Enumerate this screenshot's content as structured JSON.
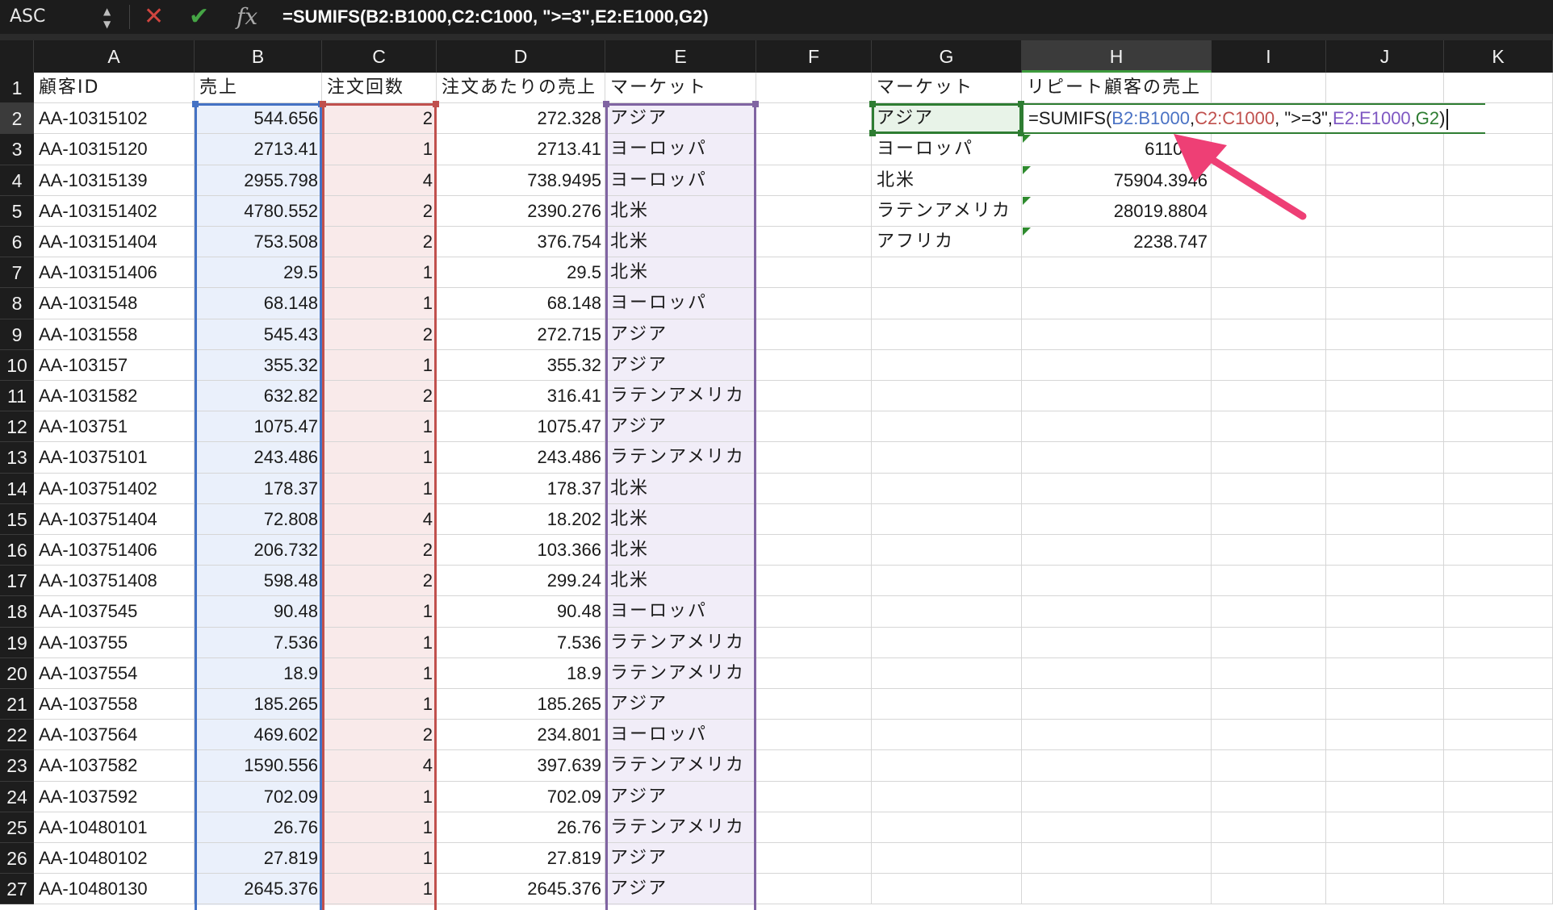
{
  "formula_bar": {
    "name_box": "ASC",
    "formula": "=SUMIFS(B2:B1000,C2:C1000, \">=3\",E2:E1000,G2)"
  },
  "icons": {
    "cancel": "cancel-icon",
    "confirm": "confirm-icon",
    "function": "fx-icon",
    "spinner": "spinner-icon"
  },
  "columns": [
    "A",
    "B",
    "C",
    "D",
    "E",
    "F",
    "G",
    "H",
    "I",
    "J",
    "K"
  ],
  "selected_column": "H",
  "selected_row": 2,
  "header_row": {
    "A": "顧客ID",
    "B": "売上",
    "C": "注文回数",
    "D": "注文あたりの売上",
    "E": "マーケット",
    "G": "マーケット",
    "H": "リピート顧客の売上"
  },
  "rows": [
    {
      "n": "2",
      "a": "AA-10315102",
      "b": "544.656",
      "c": "2",
      "d": "272.328",
      "e": "アジア",
      "g": "アジア",
      "h": ""
    },
    {
      "n": "3",
      "a": "AA-10315120",
      "b": "2713.41",
      "c": "1",
      "d": "2713.41",
      "e": "ヨーロッパ",
      "g": "ヨーロッパ",
      "h": "61100.4"
    },
    {
      "n": "4",
      "a": "AA-10315139",
      "b": "2955.798",
      "c": "4",
      "d": "738.9495",
      "e": "ヨーロッパ",
      "g": "北米",
      "h": "75904.3946"
    },
    {
      "n": "5",
      "a": "AA-103151402",
      "b": "4780.552",
      "c": "2",
      "d": "2390.276",
      "e": "北米",
      "g": "ラテンアメリカ",
      "h": "28019.8804"
    },
    {
      "n": "6",
      "a": "AA-103151404",
      "b": "753.508",
      "c": "2",
      "d": "376.754",
      "e": "北米",
      "g": "アフリカ",
      "h": "2238.747"
    },
    {
      "n": "7",
      "a": "AA-103151406",
      "b": "29.5",
      "c": "1",
      "d": "29.5",
      "e": "北米",
      "g": "",
      "h": ""
    },
    {
      "n": "8",
      "a": "AA-1031548",
      "b": "68.148",
      "c": "1",
      "d": "68.148",
      "e": "ヨーロッパ",
      "g": "",
      "h": ""
    },
    {
      "n": "9",
      "a": "AA-1031558",
      "b": "545.43",
      "c": "2",
      "d": "272.715",
      "e": "アジア",
      "g": "",
      "h": ""
    },
    {
      "n": "10",
      "a": "AA-103157",
      "b": "355.32",
      "c": "1",
      "d": "355.32",
      "e": "アジア",
      "g": "",
      "h": ""
    },
    {
      "n": "11",
      "a": "AA-1031582",
      "b": "632.82",
      "c": "2",
      "d": "316.41",
      "e": "ラテンアメリカ",
      "g": "",
      "h": ""
    },
    {
      "n": "12",
      "a": "AA-103751",
      "b": "1075.47",
      "c": "1",
      "d": "1075.47",
      "e": "アジア",
      "g": "",
      "h": ""
    },
    {
      "n": "13",
      "a": "AA-10375101",
      "b": "243.486",
      "c": "1",
      "d": "243.486",
      "e": "ラテンアメリカ",
      "g": "",
      "h": ""
    },
    {
      "n": "14",
      "a": "AA-103751402",
      "b": "178.37",
      "c": "1",
      "d": "178.37",
      "e": "北米",
      "g": "",
      "h": ""
    },
    {
      "n": "15",
      "a": "AA-103751404",
      "b": "72.808",
      "c": "4",
      "d": "18.202",
      "e": "北米",
      "g": "",
      "h": ""
    },
    {
      "n": "16",
      "a": "AA-103751406",
      "b": "206.732",
      "c": "2",
      "d": "103.366",
      "e": "北米",
      "g": "",
      "h": ""
    },
    {
      "n": "17",
      "a": "AA-103751408",
      "b": "598.48",
      "c": "2",
      "d": "299.24",
      "e": "北米",
      "g": "",
      "h": ""
    },
    {
      "n": "18",
      "a": "AA-1037545",
      "b": "90.48",
      "c": "1",
      "d": "90.48",
      "e": "ヨーロッパ",
      "g": "",
      "h": ""
    },
    {
      "n": "19",
      "a": "AA-103755",
      "b": "7.536",
      "c": "1",
      "d": "7.536",
      "e": "ラテンアメリカ",
      "g": "",
      "h": ""
    },
    {
      "n": "20",
      "a": "AA-1037554",
      "b": "18.9",
      "c": "1",
      "d": "18.9",
      "e": "ラテンアメリカ",
      "g": "",
      "h": ""
    },
    {
      "n": "21",
      "a": "AA-1037558",
      "b": "185.265",
      "c": "1",
      "d": "185.265",
      "e": "アジア",
      "g": "",
      "h": ""
    },
    {
      "n": "22",
      "a": "AA-1037564",
      "b": "469.602",
      "c": "2",
      "d": "234.801",
      "e": "ヨーロッパ",
      "g": "",
      "h": ""
    },
    {
      "n": "23",
      "a": "AA-1037582",
      "b": "1590.556",
      "c": "4",
      "d": "397.639",
      "e": "ラテンアメリカ",
      "g": "",
      "h": ""
    },
    {
      "n": "24",
      "a": "AA-1037592",
      "b": "702.09",
      "c": "1",
      "d": "702.09",
      "e": "アジア",
      "g": "",
      "h": ""
    },
    {
      "n": "25",
      "a": "AA-10480101",
      "b": "26.76",
      "c": "1",
      "d": "26.76",
      "e": "ラテンアメリカ",
      "g": "",
      "h": ""
    },
    {
      "n": "26",
      "a": "AA-10480102",
      "b": "27.819",
      "c": "1",
      "d": "27.819",
      "e": "アジア",
      "g": "",
      "h": ""
    },
    {
      "n": "27",
      "a": "AA-10480130",
      "b": "2645.376",
      "c": "1",
      "d": "2645.376",
      "e": "アジア",
      "g": "",
      "h": ""
    }
  ],
  "editing_cell": {
    "ref": "H2",
    "parts": [
      {
        "text": "=SUMIFS(",
        "color": "#1a1a1a"
      },
      {
        "text": "B2:B1000",
        "color": "#4a72c4"
      },
      {
        "text": ",",
        "color": "#1a1a1a"
      },
      {
        "text": "C2:C1000",
        "color": "#c0504d"
      },
      {
        "text": ", \">=3\",",
        "color": "#1a1a1a"
      },
      {
        "text": "E2:E1000",
        "color": "#7e57c2"
      },
      {
        "text": ",",
        "color": "#1a1a1a"
      },
      {
        "text": "G2",
        "color": "#2e7d32"
      },
      {
        "text": ")",
        "color": "#1a1a1a"
      }
    ]
  },
  "colors": {
    "range_b": "#4472c4",
    "range_c": "#c0504d",
    "range_e": "#8064a2",
    "range_g": "#2e7d32",
    "fill_b": "#eaf0fb",
    "fill_c": "#f9eaea",
    "fill_e": "#f1edf8",
    "fill_g": "#e8f3e8",
    "arrow": "#ee3f75"
  }
}
